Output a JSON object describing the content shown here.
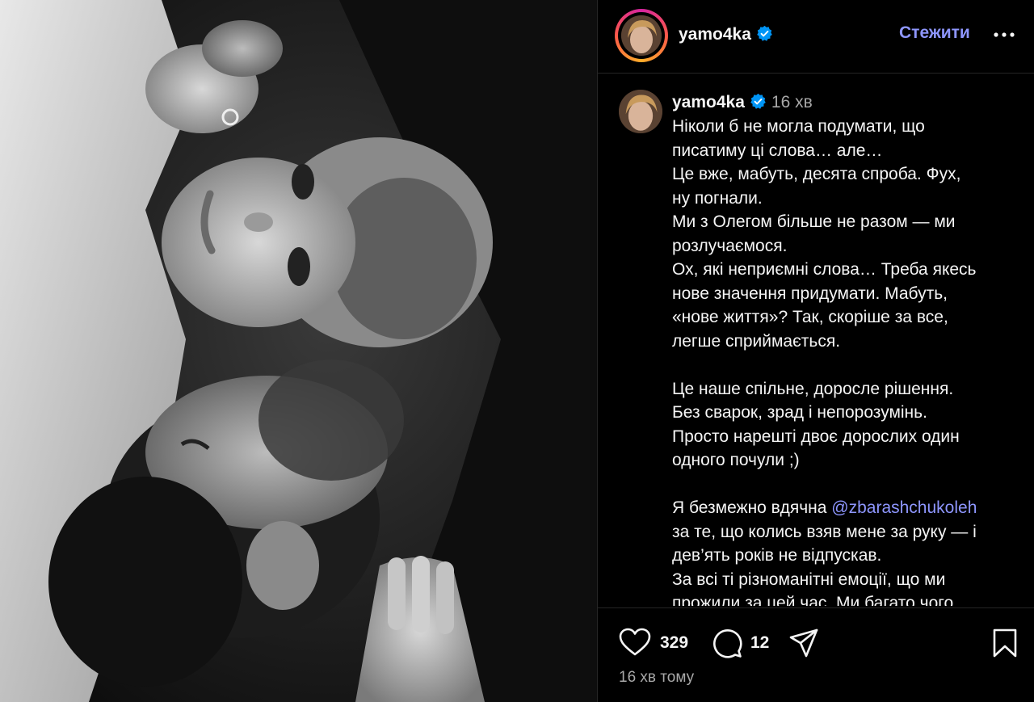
{
  "post": {
    "image_alt": "black and white photo",
    "author": {
      "username": "yamo4ka",
      "verified": true
    },
    "follow_label": "Стежити",
    "more_icon": "more-horizontal-icon",
    "caption": {
      "username": "yamo4ka",
      "time": "16 хв",
      "lines": [
        "Ніколи б не могла подумати, що",
        "писатиму ці слова… але…",
        "Це вже, мабуть, десята спроба. Фух,",
        "ну погнали.",
        "Ми з Олегом більше не разом — ми",
        "розлучаємося.",
        "Ох, які неприємні слова… Треба якесь",
        "нове значення придумати. Мабуть,",
        "«нове життя»? Так, скоріше за все,",
        "легше сприймається.",
        "",
        "Це наше спільне, доросле рішення.",
        "Без сварок, зрад і непорозумінь.",
        "Просто нарешті двоє дорослих один",
        "одного почули ;)",
        "",
        "Я безмежно вдячна ",
        "за те, що колись взяв мене за руку — і",
        "дев’ять років не відпускав.",
        "За всі ті різноманітні емоції, що ми",
        "прожили за цей час. Ми багато чого"
      ],
      "mention": "@zbarashchukoleh"
    },
    "actions": {
      "likes": "329",
      "comments": "12",
      "like_icon": "heart-icon",
      "comment_icon": "comment-icon",
      "share_icon": "share-icon",
      "save_icon": "bookmark-icon"
    },
    "posted_ago": "16 хв тому",
    "colors": {
      "accent": "#8e96ff",
      "verified": "#0095f6",
      "muted": "#a8a8a8"
    }
  }
}
